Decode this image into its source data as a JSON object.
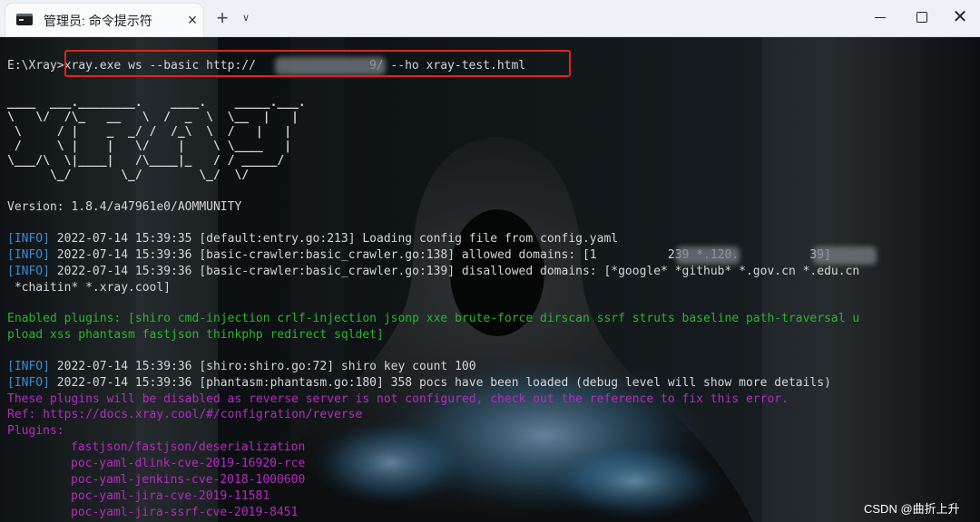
{
  "window": {
    "tab_title": "管理员: 命令提示符",
    "tab_close_icon": "×",
    "new_tab_icon": "+",
    "tab_dropdown_icon": "∨",
    "minimize_icon": "minimize",
    "maximize_icon": "maximize",
    "close_icon": "✕"
  },
  "terminal": {
    "prompt": "E:\\Xray>",
    "command_part1": "xray.exe ws --basic http://",
    "command_part2": "9/ --ho xray-test.html",
    "ascii_banner": [
      "____  ___.________.    ____.    _____.___.",
      "\\   \\/  /\\_   __   \\  /  _  \\  \\__  |   |",
      " \\     / |    _  _/ /  /_\\  \\  /   |   |",
      " /     \\ |    |   \\/    |    \\ \\____   |",
      "\\___/\\  \\|____|   /\\____|_   / / _____/",
      "      \\_/       \\_/        \\_/  \\/"
    ],
    "version": "Version: 1.8.4/a47961e0/AOMMUNITY",
    "log_lines": [
      {
        "tag": "[INFO]",
        "text": " 2022-07-14 15:39:35 [default:entry.go:213] Loading config file from config.yaml"
      },
      {
        "tag": "[INFO]",
        "text": " 2022-07-14 15:39:36 [basic-crawler:basic_crawler.go:138] allowed domains: [1          239 *.120.          39]"
      },
      {
        "tag": "[INFO]",
        "text": " 2022-07-14 15:39:36 [basic-crawler:basic_crawler.go:139] disallowed domains: [*google* *github* *.gov.cn *.edu.cn"
      }
    ],
    "disallowed_cont": " *chaitin* *.xray.cool]",
    "enabled_plugins_1": "Enabled plugins: [shiro cmd-injection crlf-injection jsonp xxe brute-force dirscan ssrf struts baseline path-traversal u",
    "enabled_plugins_2": "pload xss phantasm fastjson thinkphp redirect sqldet]",
    "log_lines_2": [
      {
        "tag": "[INFO]",
        "text": " 2022-07-14 15:39:36 [shiro:shiro.go:72] shiro key count 100"
      },
      {
        "tag": "[INFO]",
        "text": " 2022-07-14 15:39:36 [phantasm:phantasm.go:180] 358 pocs have been loaded (debug level will show more details)"
      }
    ],
    "warning": "These plugins will be disabled as reverse server is not configured, check out the reference to fix this error.",
    "ref": "Ref: https://docs.xray.cool/#/configration/reverse",
    "plugins_label": "Plugins:",
    "plugins": [
      "fastjson/fastjson/deserialization",
      "poc-yaml-dlink-cve-2019-16920-rce",
      "poc-yaml-jenkins-cve-2018-1000600",
      "poc-yaml-jira-cve-2019-11581",
      "poc-yaml-jira-ssrf-cve-2019-8451"
    ]
  },
  "watermark": "CSDN @曲折上升",
  "colors": {
    "info_tag": "#3a8bd4",
    "enabled_plugins": "#2cb52c",
    "warning": "#b62bc2",
    "highlight_box": "#e0241c"
  }
}
